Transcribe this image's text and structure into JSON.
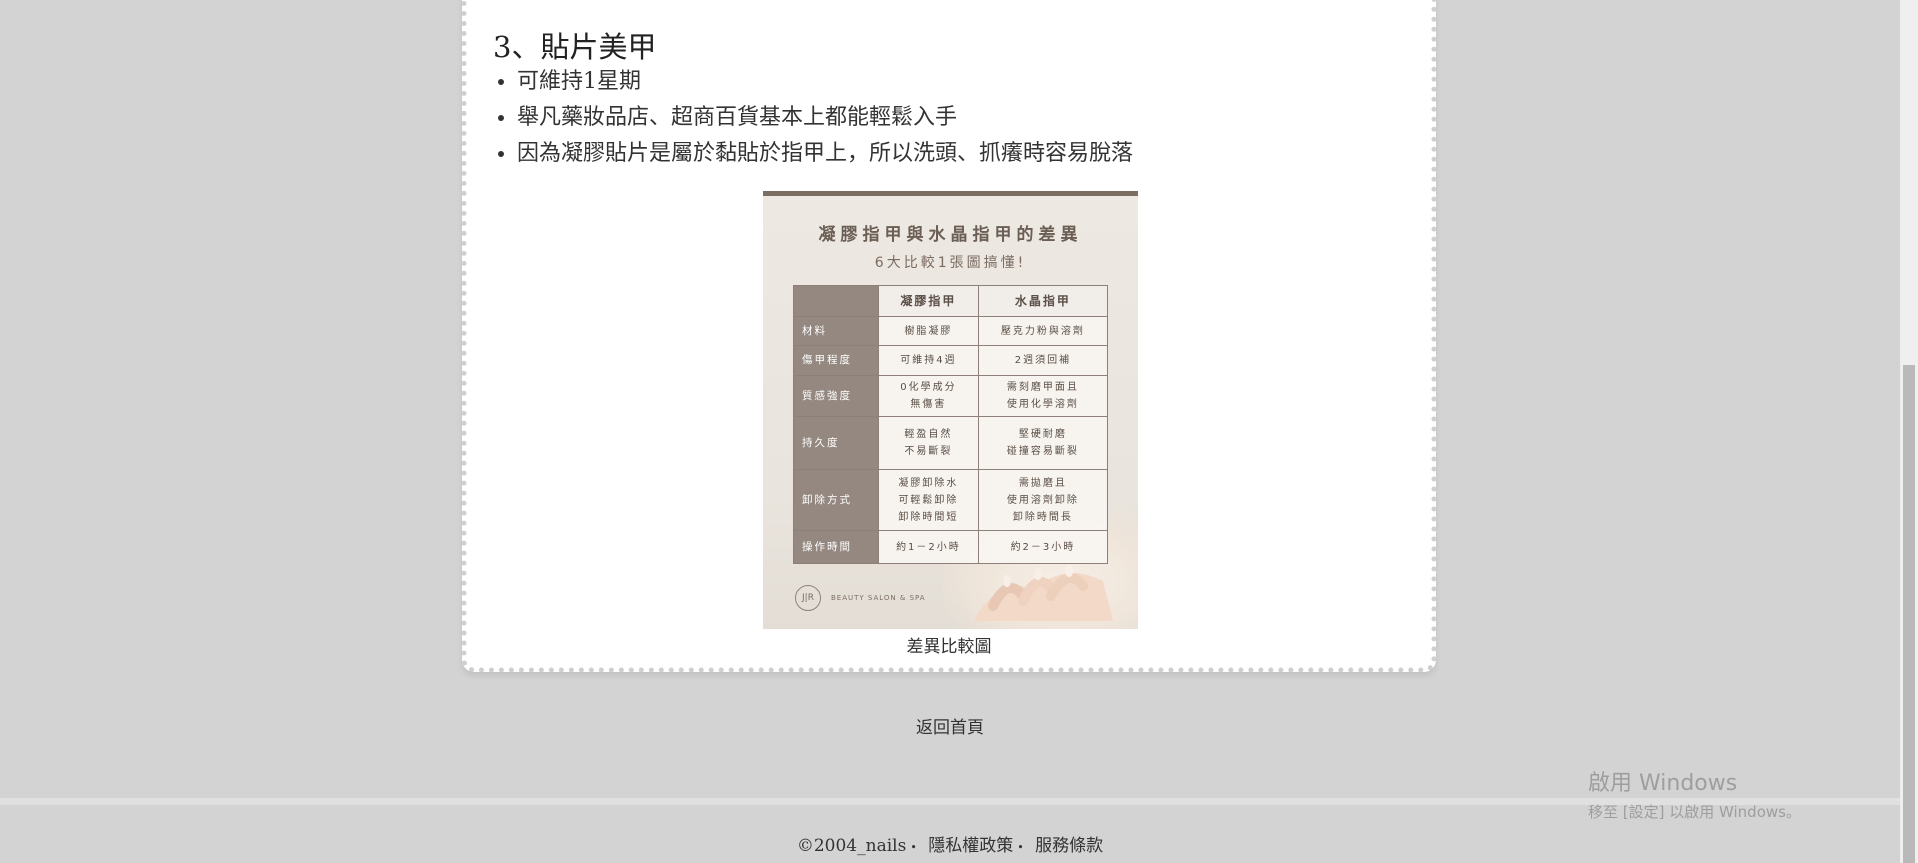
{
  "article": {
    "section_heading": "3、貼片美甲",
    "bullets": [
      "可維持1星期",
      "舉凡藥妝品店、超商百貨基本上都能輕鬆入手",
      "因為凝膠貼片是屬於黏貼於指甲上，所以洗頭、抓癢時容易脫落"
    ],
    "image": {
      "title": "凝膠指甲與水晶指甲的差異",
      "subtitle": "6大比較1張圖搞懂!",
      "columns": [
        "凝膠指甲",
        "水晶指甲"
      ],
      "rows": [
        {
          "label": "材料",
          "gel": "樹脂凝膠",
          "crystal": "壓克力粉與溶劑"
        },
        {
          "label": "傷甲程度",
          "gel": "可維持4週",
          "crystal": "2週須回補"
        },
        {
          "label": "質感強度",
          "gel_lines": [
            "0化學成分",
            "無傷害"
          ],
          "crystal_lines": [
            "需刻磨甲面且",
            "使用化學溶劑"
          ]
        },
        {
          "label": "持久度",
          "gel_lines": [
            "輕盈自然",
            "不易斷裂"
          ],
          "crystal_lines": [
            "堅硬耐磨",
            "碰撞容易斷裂"
          ]
        },
        {
          "label": "卸除方式",
          "gel_lines": [
            "凝膠卸除水",
            "可輕鬆卸除",
            "卸除時間短"
          ],
          "crystal_lines": [
            "需拋磨且",
            "使用溶劑卸除",
            "卸除時間長"
          ]
        },
        {
          "label": "操作時間",
          "gel": "約1－2小時",
          "crystal": "約2－3小時"
        }
      ],
      "brand_logo": "J|R",
      "brand_text": "BEAUTY SALON & SPA"
    },
    "caption": "差異比較圖"
  },
  "nav": {
    "home_link": "返回首頁"
  },
  "footer": {
    "copyright": "©2004_nails",
    "separator": "•",
    "privacy": "隱私權政策",
    "terms": "服務條款"
  },
  "watermark": {
    "title": "啟用 Windows",
    "subtitle": "移至 [設定] 以啟用 Windows。"
  }
}
